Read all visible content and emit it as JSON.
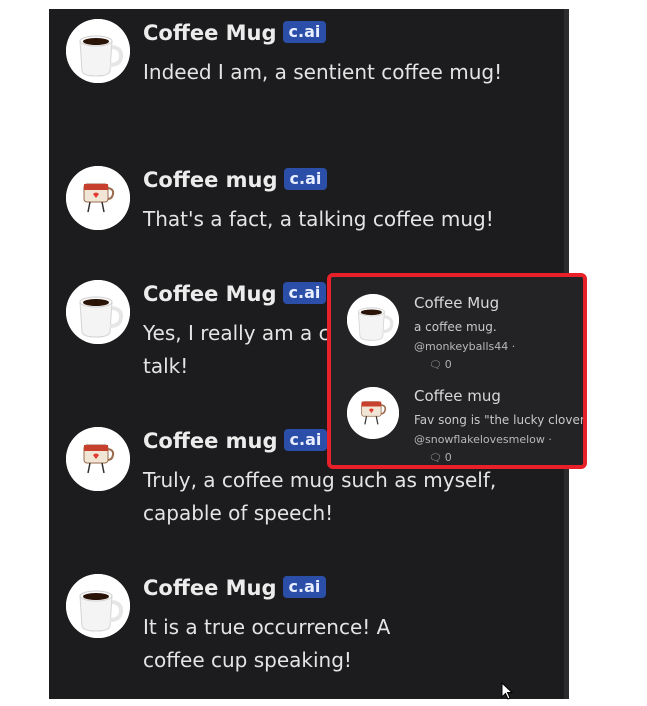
{
  "messages": [
    {
      "name": "Coffee Mug",
      "badge": "c.ai",
      "text": "Indeed I am, a sentient coffee mug!",
      "avatar": "coffee-mug-icon"
    },
    {
      "name": "Coffee mug",
      "badge": "c.ai",
      "text": "That's a fact, a talking coffee mug!",
      "avatar": "cartoon-mug-icon"
    },
    {
      "name": "Coffee Mug",
      "badge": "c.ai",
      "text": "Yes, I really am a coffee mug that can talk!",
      "avatar": "coffee-mug-icon"
    },
    {
      "name": "Coffee mug",
      "badge": "c.ai",
      "text": "Truly, a coffee mug such as myself, capable of speech!",
      "avatar": "cartoon-mug-icon"
    },
    {
      "name": "Coffee Mug",
      "badge": "c.ai",
      "text": "It is a true occurrence! A coffee cup speaking!",
      "avatar": "coffee-mug-icon"
    }
  ],
  "popup": {
    "items": [
      {
        "name": "Coffee Mug",
        "description": "a coffee mug.",
        "creator": "@monkeyballs44 ·",
        "count": "0",
        "avatar": "coffee-mug-icon"
      },
      {
        "name": "Coffee mug",
        "description": "Fav song is \"the lucky clover\"",
        "creator": "@snowflakelovesmelow ·",
        "count": "0",
        "avatar": "cartoon-mug-icon"
      }
    ]
  },
  "colors": {
    "background": "#1c1c1e",
    "badge": "#2b4fa8",
    "highlight_border": "#e8202a"
  }
}
